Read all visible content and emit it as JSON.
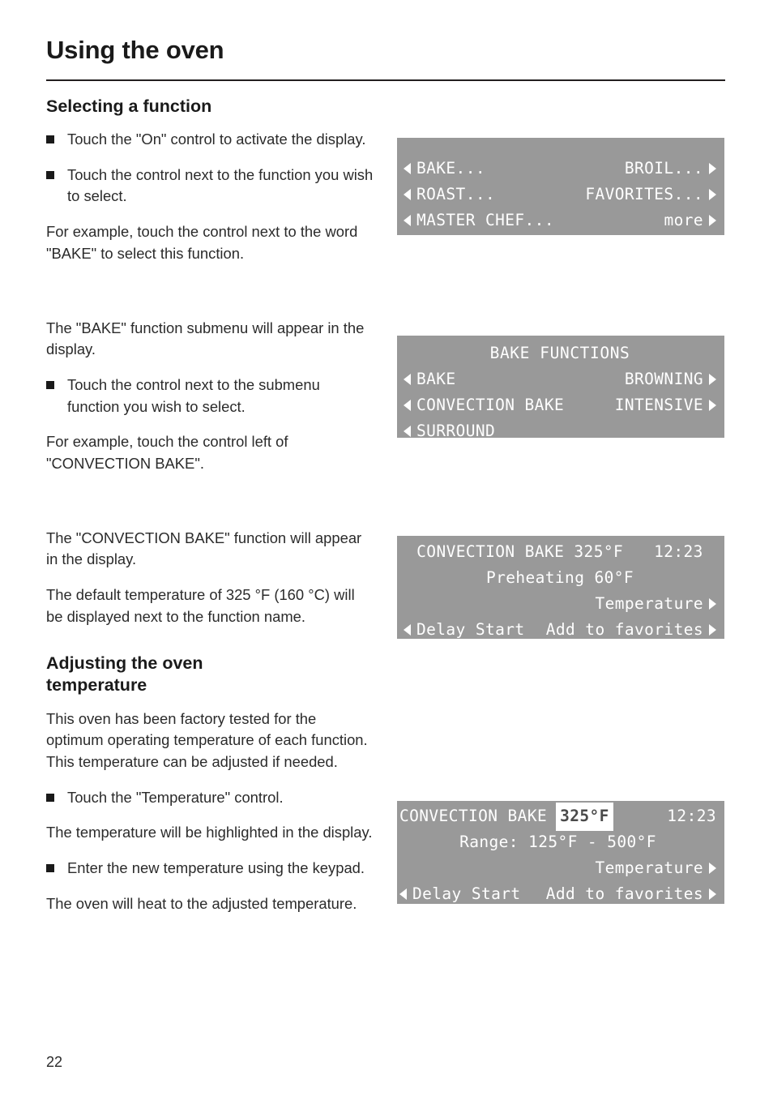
{
  "header": {
    "title": "Using the oven"
  },
  "sections": {
    "selecting": {
      "heading": "Selecting a function",
      "bullet1": "Touch the \"On\" control to activate the display.",
      "bullet2": "Touch the control next to the function you wish to select.",
      "para1": "For example, touch the control next to the word \"BAKE\" to select this function.",
      "para2": "The \"BAKE\" function submenu will appear in the display.",
      "bullet3": "Touch the control next to the submenu function you wish to select.",
      "para3": "For example, touch the control left of \"CONVECTION BAKE\".",
      "para4": "The \"CONVECTION BAKE\" function will appear in the display.",
      "para5": "The default temperature of 325 °F (160 °C) will be displayed next to the function name."
    },
    "adjusting": {
      "heading_line1": "Adjusting the oven",
      "heading_line2": "temperature",
      "para1": "This oven has been factory tested for the optimum operating temperature of each function. This temperature can be adjusted if needed.",
      "bullet1": "Touch the \"Temperature\" control.",
      "para2": "The temperature will be highlighted in the display.",
      "bullet2": "Enter the new temperature using the keypad.",
      "para3": "The oven will heat to the adjusted temperature."
    }
  },
  "displays": {
    "main_menu": {
      "rows": [
        {
          "left": "BAKE...",
          "right": "BROIL..."
        },
        {
          "left": "ROAST...",
          "right": "FAVORITES..."
        },
        {
          "left": "MASTER CHEF...",
          "right": "more"
        }
      ]
    },
    "bake_functions": {
      "title": "BAKE FUNCTIONS",
      "rows": [
        {
          "left": "BAKE",
          "right": "BROWNING"
        },
        {
          "left": "CONVECTION BAKE",
          "right": "INTENSIVE"
        },
        {
          "left": "SURROUND",
          "right": ""
        }
      ]
    },
    "convection_running": {
      "function_name": "CONVECTION BAKE 325°F",
      "clock": "12:23",
      "status": "Preheating 60°F",
      "temperature_label": "Temperature",
      "delay_start_label": "Delay Start",
      "favorites_label": "Add to favorites"
    },
    "convection_editing": {
      "function_name": "CONVECTION BAKE",
      "temperature_value": "325°F",
      "clock": "12:23",
      "range_text": "Range: 125°F - 500°F",
      "temperature_label": "Temperature",
      "delay_start_label": "Delay Start",
      "favorites_label": "Add to favorites"
    }
  },
  "footer": {
    "page_number": "22"
  }
}
